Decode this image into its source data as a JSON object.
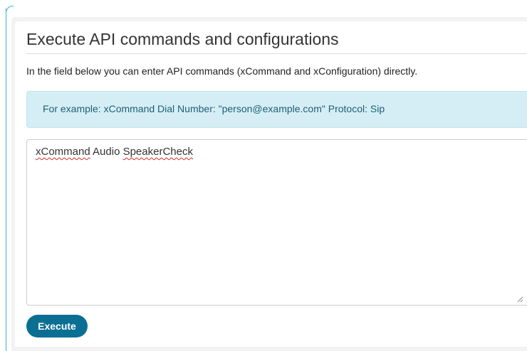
{
  "page": {
    "title": "Execute API commands and configurations",
    "description": "In the field below you can enter API commands (xCommand and xConfiguration) directly."
  },
  "example": {
    "text": "For example: xCommand Dial Number: \"person@example.com\" Protocol: Sip"
  },
  "command_input": {
    "value_parts": [
      "xCommand",
      " Audio ",
      "SpeakerCheck"
    ]
  },
  "actions": {
    "execute_label": "Execute"
  },
  "colors": {
    "accent": "#0b6f94",
    "example_bg": "#d5eef5",
    "example_text": "#1e5f74",
    "spellcheck": "#d42b2b"
  }
}
